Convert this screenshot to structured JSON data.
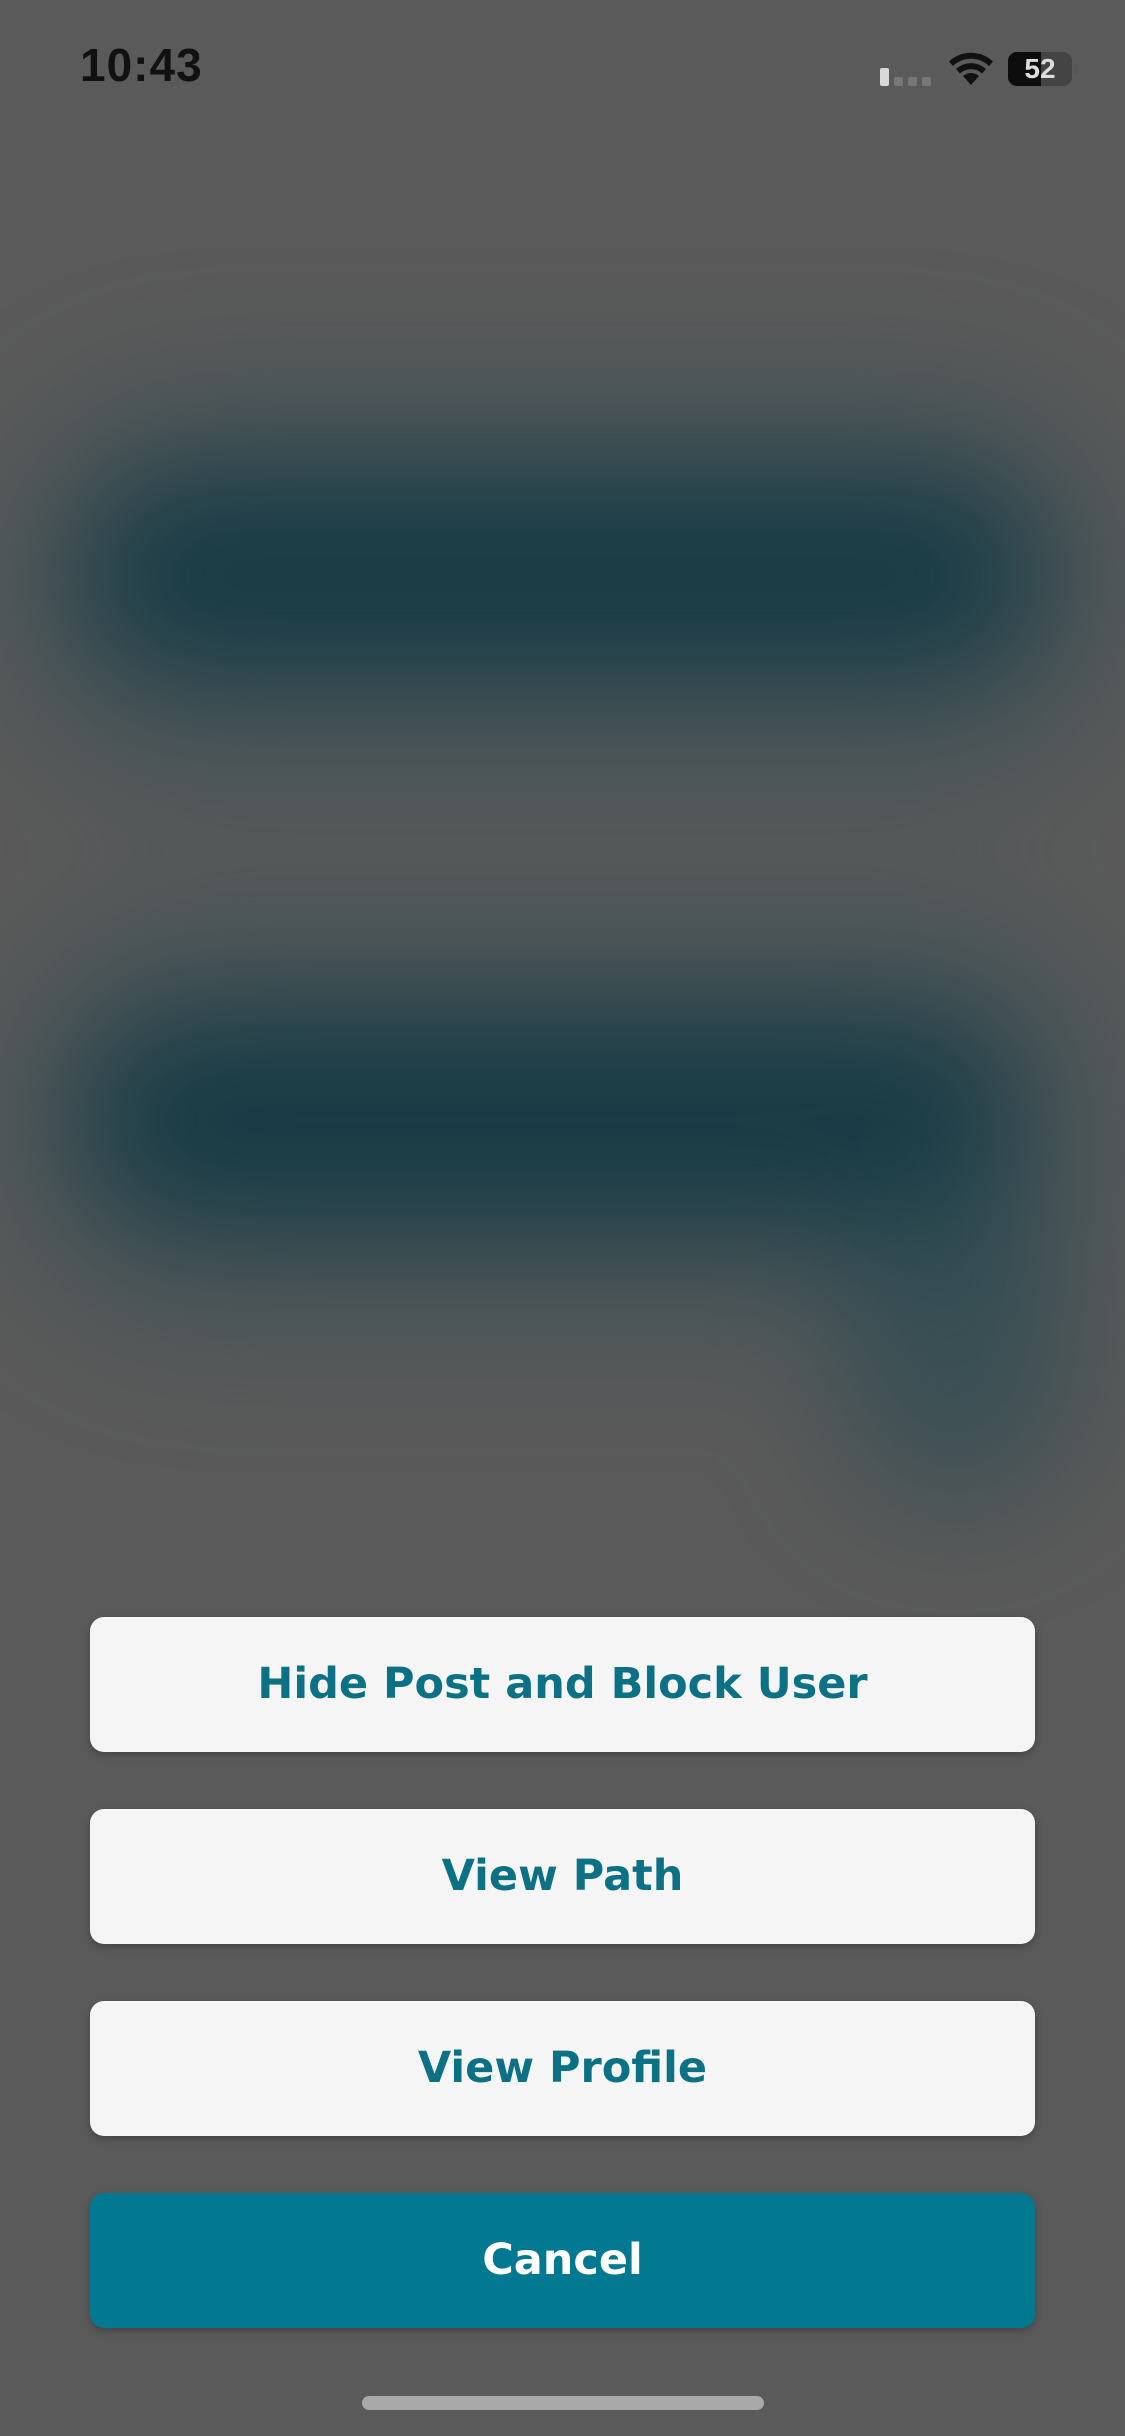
{
  "status_bar": {
    "time": "10:43",
    "battery_level": "52",
    "battery_percent": 52,
    "signal_bars": 1,
    "signal_bars_total": 4,
    "icons": [
      "cellular-signal-icon",
      "wifi-icon",
      "battery-icon"
    ]
  },
  "background": {
    "overlay_color": "#5a5a5a",
    "content_tint": "#163a44"
  },
  "action_sheet": {
    "actions": [
      {
        "label": "Hide Post and Block User"
      },
      {
        "label": "View Path"
      },
      {
        "label": "View Profile"
      }
    ],
    "cancel_label": "Cancel"
  },
  "colors": {
    "accent": "#037891",
    "button_text": "#0d7186",
    "button_background": "#f5f5f5"
  }
}
